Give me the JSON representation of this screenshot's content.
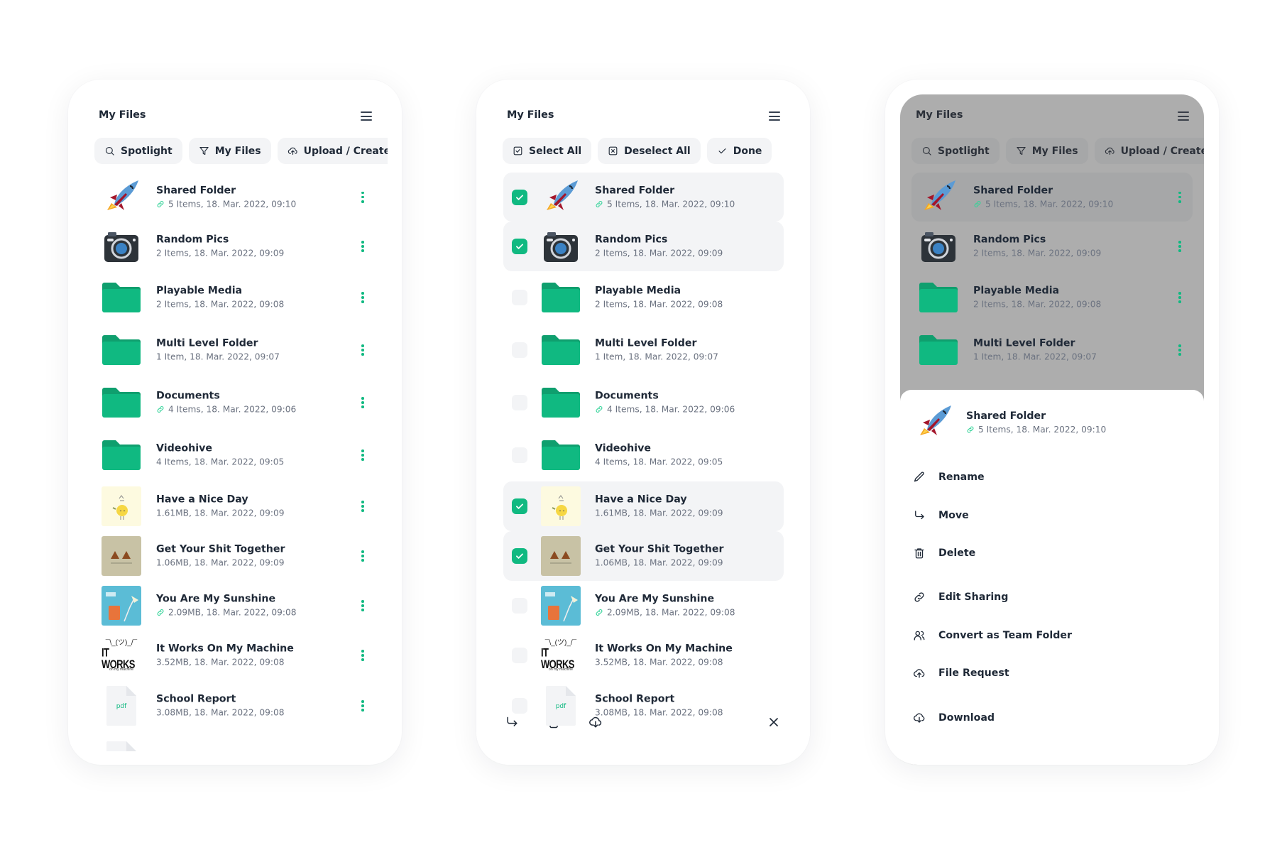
{
  "colors": {
    "accent": "#10b981",
    "folder_dark": "#0f9f6e",
    "text_primary": "#1f2937",
    "text_secondary": "#6b7280",
    "chip_bg": "#f3f4f6"
  },
  "screens": [
    {
      "id": "browse",
      "title": "My Files",
      "menu_icon": "hamburger-icon",
      "chips": [
        {
          "label": "Spotlight",
          "icon": "search-icon"
        },
        {
          "label": "My Files",
          "icon": "filter-icon"
        },
        {
          "label": "Upload / Create",
          "icon": "cloud-upload-icon"
        }
      ],
      "items": [
        {
          "name": "Shared Folder",
          "meta": "5 Items, 18. Mar. 2022, 09:10",
          "shared": true,
          "thumb": "rocket"
        },
        {
          "name": "Random Pics",
          "meta": "2 Items, 18. Mar. 2022, 09:09",
          "shared": false,
          "thumb": "camera"
        },
        {
          "name": "Playable Media",
          "meta": "2 Items, 18. Mar. 2022, 09:08",
          "shared": false,
          "thumb": "folder"
        },
        {
          "name": "Multi Level Folder",
          "meta": "1 Item, 18. Mar. 2022, 09:07",
          "shared": false,
          "thumb": "folder"
        },
        {
          "name": "Documents",
          "meta": "4 Items, 18. Mar. 2022, 09:06",
          "shared": true,
          "thumb": "folder"
        },
        {
          "name": "Videohive",
          "meta": "4 Items, 18. Mar. 2022, 09:05",
          "shared": false,
          "thumb": "folder"
        },
        {
          "name": "Have a Nice Day",
          "meta": "1.61MB, 18. Mar. 2022, 09:09",
          "shared": false,
          "thumb": "sun-image"
        },
        {
          "name": "Get Your Shit Together",
          "meta": "1.06MB, 18. Mar. 2022, 09:09",
          "shared": false,
          "thumb": "poop-image"
        },
        {
          "name": "You Are My Sunshine",
          "meta": "2.09MB, 18. Mar. 2022, 09:08",
          "shared": true,
          "thumb": "lamp-image"
        },
        {
          "name": "It Works On My Machine",
          "meta": "3.52MB, 18. Mar. 2022, 09:08",
          "shared": false,
          "thumb": "itworks-image"
        },
        {
          "name": "School Report",
          "meta": "3.08MB, 18. Mar. 2022, 09:08",
          "shared": false,
          "thumb": "pdf"
        }
      ],
      "pdf_label": "pdf",
      "itworks_shrug": "¯\\_(ツ)_/¯",
      "itworks_big": "IT WORKS",
      "itworks_small": "on my machine"
    },
    {
      "id": "select",
      "title": "My Files",
      "chips": [
        {
          "label": "Select All",
          "icon": "check-square-icon"
        },
        {
          "label": "Deselect All",
          "icon": "x-square-icon"
        },
        {
          "label": "Done",
          "icon": "check-icon"
        }
      ],
      "selected": [
        true,
        true,
        false,
        false,
        false,
        false,
        true,
        true,
        false,
        false,
        false
      ],
      "bottom_actions": [
        {
          "action": "move",
          "icon": "move-arrow-icon"
        },
        {
          "action": "delete",
          "icon": "trash-icon"
        },
        {
          "action": "download",
          "icon": "cloud-download-icon"
        },
        {
          "action": "close",
          "icon": "close-icon"
        }
      ]
    },
    {
      "id": "context-menu",
      "title": "My Files",
      "highlighted_index": 0,
      "sheet": {
        "name": "Shared Folder",
        "meta": "5 Items, 18. Mar. 2022, 09:10",
        "shared": true,
        "actions": [
          {
            "label": "Rename",
            "icon": "pencil-icon"
          },
          {
            "label": "Move",
            "icon": "move-arrow-icon"
          },
          {
            "label": "Delete",
            "icon": "trash-icon"
          },
          {
            "label": "Edit Sharing",
            "icon": "link-icon"
          },
          {
            "label": "Convert as Team Folder",
            "icon": "users-icon"
          },
          {
            "label": "File Request",
            "icon": "cloud-upload-icon"
          },
          {
            "label": "Download",
            "icon": "cloud-download-icon"
          }
        ]
      }
    }
  ]
}
